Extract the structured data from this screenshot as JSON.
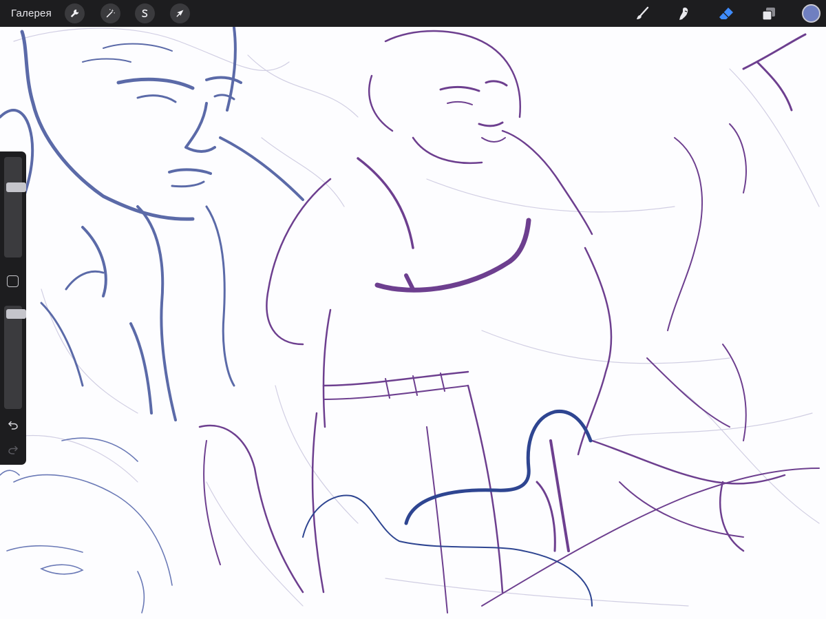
{
  "app": {
    "gallery_label": "Галерея"
  },
  "toolbar_left": [
    {
      "name": "actions-icon"
    },
    {
      "name": "adjustments-icon"
    },
    {
      "name": "selection-icon"
    },
    {
      "name": "transform-icon"
    }
  ],
  "toolbar_right": [
    {
      "name": "brush-icon"
    },
    {
      "name": "smudge-icon"
    },
    {
      "name": "eraser-icon",
      "active": true
    },
    {
      "name": "layers-icon"
    }
  ],
  "colors": {
    "toolbar_bg": "#1d1d1f",
    "active_tool": "#3f8cff",
    "current_color": "#6f7fc0",
    "ink_blue": "#5b6aa8",
    "ink_purple": "#6d3f8f",
    "ink_navy": "#2e4591"
  },
  "sidebar": {
    "brush_size_level": 0.28,
    "opacity_level": 0.04
  }
}
